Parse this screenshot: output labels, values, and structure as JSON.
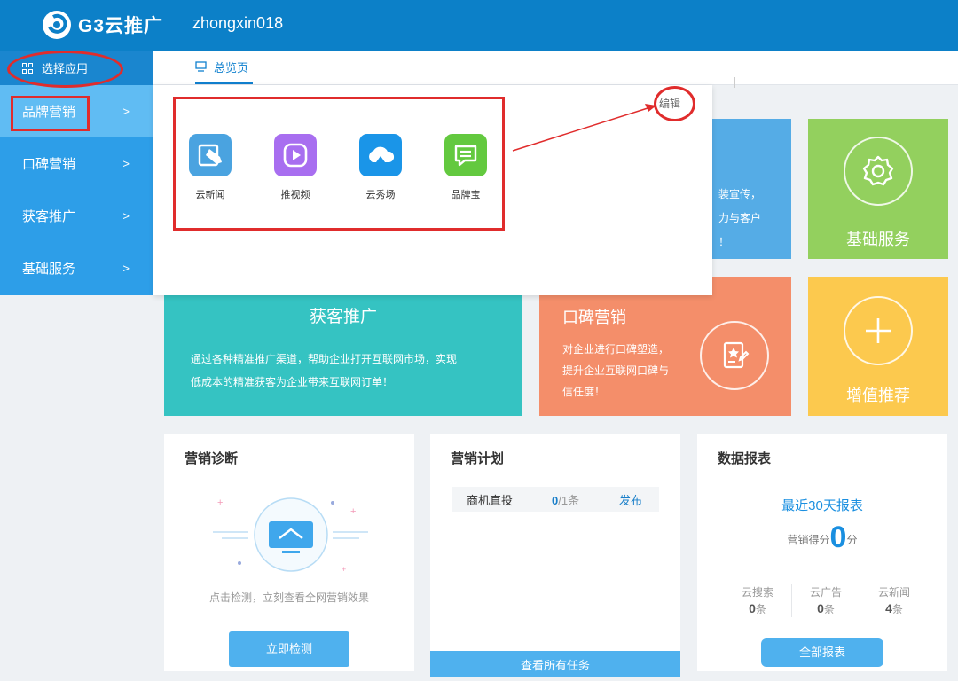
{
  "header": {
    "logo_text": "G3云推广",
    "username": "zhongxin018"
  },
  "sidebar": {
    "choose_app": "选择应用",
    "items": [
      {
        "label": "品牌营销",
        "arrow": ">"
      },
      {
        "label": "口碑营销",
        "arrow": ">"
      },
      {
        "label": "获客推广",
        "arrow": ">"
      },
      {
        "label": "基础服务",
        "arrow": ">"
      }
    ]
  },
  "tabs": {
    "overview": "总览页"
  },
  "dropdown": {
    "edit": "编辑",
    "apps": [
      {
        "label": "云新闻",
        "icon": "news-icon",
        "color": "#4aa3e0"
      },
      {
        "label": "推视频",
        "icon": "video-play-icon",
        "color": "#a86ef0"
      },
      {
        "label": "云秀场",
        "icon": "cloud-show-icon",
        "color": "#1a95e8"
      },
      {
        "label": "品牌宝",
        "icon": "message-icon",
        "color": "#63c93f"
      }
    ]
  },
  "tiles": {
    "brand_desc": [
      "装宣传，",
      "力与客户",
      "！"
    ],
    "basic_service": "基础服务",
    "acquire_title": "获客推广",
    "acquire_desc": [
      "通过各种精准推广渠道，帮助企业打开互联网市场，实现",
      "低成本的精准获客为企业带来互联网订单！"
    ],
    "word_title": "口碑营销",
    "word_desc": [
      "对企业进行口碑塑造，",
      "提升企业互联网口碑与",
      "信任度！"
    ],
    "value_add": "增值推荐"
  },
  "diagnosis": {
    "title": "营销诊断",
    "hint": "点击检测，立刻查看全网营销效果",
    "button": "立即检测"
  },
  "plan": {
    "title": "营销计划",
    "row": {
      "name": "商机直投",
      "done": "0",
      "total": "/1条",
      "action": "发布"
    },
    "footer": "查看所有任务"
  },
  "report": {
    "title": "数据报表",
    "subtitle": "最近30天报表",
    "score_label": "营销得分",
    "score": "0",
    "score_unit": "分",
    "stats": [
      {
        "label": "云搜索",
        "value": "0",
        "unit": "条"
      },
      {
        "label": "云广告",
        "value": "0",
        "unit": "条"
      },
      {
        "label": "云新闻",
        "value": "4",
        "unit": "条"
      }
    ],
    "button": "全部报表"
  },
  "colors": {
    "header": "#0c80c8",
    "sidebar": "#2d9ee8",
    "annotation_red": "#e02c2c"
  }
}
